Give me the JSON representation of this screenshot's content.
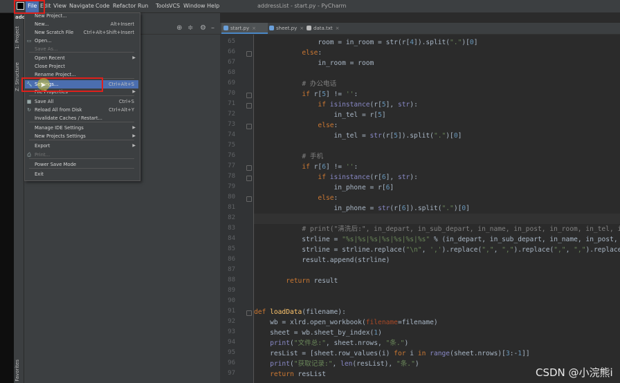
{
  "window_title": "addressList - start.py - PyCharm",
  "menubar": [
    "File",
    "Edit",
    "View",
    "Navigate",
    "Code",
    "Refactor",
    "Run",
    "Tools",
    "VCS",
    "Window",
    "Help"
  ],
  "project_title_partial": "add",
  "side_tabs": {
    "project": "1: Project",
    "structure": "Z: Structure",
    "favorites": "Favorites"
  },
  "tabs": [
    {
      "label": "start.py",
      "active": true
    },
    {
      "label": "sheet.py",
      "active": false
    },
    {
      "label": "data.txt",
      "active": false
    }
  ],
  "file_menu": [
    {
      "label": "New Project...",
      "shortcut": "",
      "submenu": false,
      "disabled": false,
      "icon": ""
    },
    {
      "label": "New...",
      "shortcut": "Alt+Insert",
      "submenu": false,
      "disabled": false,
      "icon": ""
    },
    {
      "label": "New Scratch File",
      "shortcut": "Ctrl+Alt+Shift+Insert",
      "submenu": false,
      "disabled": false,
      "icon": ""
    },
    {
      "label": "Open...",
      "shortcut": "",
      "submenu": false,
      "disabled": false,
      "icon": "folder-icon"
    },
    {
      "label": "Save As...",
      "shortcut": "",
      "submenu": false,
      "disabled": true,
      "icon": ""
    },
    {
      "label": "Open Recent",
      "shortcut": "",
      "submenu": true,
      "disabled": false,
      "icon": ""
    },
    {
      "label": "Close Project",
      "shortcut": "",
      "submenu": false,
      "disabled": false,
      "icon": ""
    },
    {
      "label": "Rename Project...",
      "shortcut": "",
      "submenu": false,
      "disabled": false,
      "icon": ""
    },
    {
      "label": "Settings...",
      "shortcut": "Ctrl+Alt+S",
      "submenu": false,
      "disabled": false,
      "icon": "wrench-icon",
      "selected": true
    },
    {
      "label": "File Properties",
      "shortcut": "",
      "submenu": true,
      "disabled": false,
      "icon": ""
    },
    {
      "label": "Save All",
      "shortcut": "Ctrl+S",
      "submenu": false,
      "disabled": false,
      "icon": "save-icon"
    },
    {
      "label": "Reload All from Disk",
      "shortcut": "Ctrl+Alt+Y",
      "submenu": false,
      "disabled": false,
      "icon": "reload-icon"
    },
    {
      "label": "Invalidate Caches / Restart...",
      "shortcut": "",
      "submenu": false,
      "disabled": false,
      "icon": ""
    },
    {
      "label": "Manage IDE Settings",
      "shortcut": "",
      "submenu": true,
      "disabled": false,
      "icon": ""
    },
    {
      "label": "New Projects Settings",
      "shortcut": "",
      "submenu": true,
      "disabled": false,
      "icon": ""
    },
    {
      "label": "Export",
      "shortcut": "",
      "submenu": true,
      "disabled": false,
      "icon": ""
    },
    {
      "label": "Print...",
      "shortcut": "",
      "submenu": false,
      "disabled": true,
      "icon": "print-icon"
    },
    {
      "label": "Power Save Mode",
      "shortcut": "",
      "submenu": false,
      "disabled": false,
      "icon": ""
    },
    {
      "label": "Exit",
      "shortcut": "",
      "submenu": false,
      "disabled": false,
      "icon": ""
    }
  ],
  "line_numbers": [
    "65",
    "66",
    "67",
    "68",
    "69",
    "70",
    "71",
    "72",
    "73",
    "74",
    "75",
    "76",
    "77",
    "78",
    "79",
    "80",
    "81",
    "82",
    "83",
    "84",
    "85",
    "86",
    "87",
    "88",
    "89",
    "90",
    "91",
    "92",
    "93",
    "94",
    "95",
    "96",
    "97"
  ],
  "code_lines": [
    [
      {
        "t": "                room = in_room = str(r[",
        "c": ""
      },
      {
        "t": "4",
        "c": "num"
      },
      {
        "t": "]).split(",
        "c": ""
      },
      {
        "t": "\".\"",
        "c": "str"
      },
      {
        "t": ")[",
        "c": ""
      },
      {
        "t": "0",
        "c": "num"
      },
      {
        "t": "]",
        "c": ""
      }
    ],
    [
      {
        "t": "            ",
        "c": ""
      },
      {
        "t": "else",
        "c": "kw"
      },
      {
        "t": ":",
        "c": ""
      }
    ],
    [
      {
        "t": "                in_room = room",
        "c": ""
      }
    ],
    [
      {
        "t": "",
        "c": ""
      }
    ],
    [
      {
        "t": "            ",
        "c": ""
      },
      {
        "t": "# 办公电话",
        "c": "cm"
      }
    ],
    [
      {
        "t": "            ",
        "c": ""
      },
      {
        "t": "if",
        "c": "kw"
      },
      {
        "t": " r[",
        "c": ""
      },
      {
        "t": "5",
        "c": "num"
      },
      {
        "t": "] != ",
        "c": ""
      },
      {
        "t": "''",
        "c": "str"
      },
      {
        "t": ":",
        "c": ""
      }
    ],
    [
      {
        "t": "                ",
        "c": ""
      },
      {
        "t": "if",
        "c": "kw"
      },
      {
        "t": " ",
        "c": ""
      },
      {
        "t": "isinstance",
        "c": "bi"
      },
      {
        "t": "(r[",
        "c": ""
      },
      {
        "t": "5",
        "c": "num"
      },
      {
        "t": "], ",
        "c": ""
      },
      {
        "t": "str",
        "c": "bi"
      },
      {
        "t": "):",
        "c": ""
      }
    ],
    [
      {
        "t": "                    in_tel = r[",
        "c": ""
      },
      {
        "t": "5",
        "c": "num"
      },
      {
        "t": "]",
        "c": ""
      }
    ],
    [
      {
        "t": "                ",
        "c": ""
      },
      {
        "t": "else",
        "c": "kw"
      },
      {
        "t": ":",
        "c": ""
      }
    ],
    [
      {
        "t": "                    in_tel = ",
        "c": ""
      },
      {
        "t": "str",
        "c": "bi"
      },
      {
        "t": "(r[",
        "c": ""
      },
      {
        "t": "5",
        "c": "num"
      },
      {
        "t": "]).split(",
        "c": ""
      },
      {
        "t": "\".\"",
        "c": "str"
      },
      {
        "t": ")[",
        "c": ""
      },
      {
        "t": "0",
        "c": "num"
      },
      {
        "t": "]",
        "c": ""
      }
    ],
    [
      {
        "t": "",
        "c": ""
      }
    ],
    [
      {
        "t": "            ",
        "c": ""
      },
      {
        "t": "# 手机",
        "c": "cm"
      }
    ],
    [
      {
        "t": "            ",
        "c": ""
      },
      {
        "t": "if",
        "c": "kw"
      },
      {
        "t": " r[",
        "c": ""
      },
      {
        "t": "6",
        "c": "num"
      },
      {
        "t": "] != ",
        "c": ""
      },
      {
        "t": "''",
        "c": "str"
      },
      {
        "t": ":",
        "c": ""
      }
    ],
    [
      {
        "t": "                ",
        "c": ""
      },
      {
        "t": "if",
        "c": "kw"
      },
      {
        "t": " ",
        "c": ""
      },
      {
        "t": "isinstance",
        "c": "bi"
      },
      {
        "t": "(r[",
        "c": ""
      },
      {
        "t": "6",
        "c": "num"
      },
      {
        "t": "], ",
        "c": ""
      },
      {
        "t": "str",
        "c": "bi"
      },
      {
        "t": "):",
        "c": ""
      }
    ],
    [
      {
        "t": "                    in_phone = r[",
        "c": ""
      },
      {
        "t": "6",
        "c": "num"
      },
      {
        "t": "]",
        "c": ""
      }
    ],
    [
      {
        "t": "                ",
        "c": ""
      },
      {
        "t": "else",
        "c": "kw"
      },
      {
        "t": ":",
        "c": ""
      }
    ],
    [
      {
        "t": "                    in_phone = ",
        "c": ""
      },
      {
        "t": "str",
        "c": "bi"
      },
      {
        "t": "(r[",
        "c": ""
      },
      {
        "t": "6",
        "c": "num"
      },
      {
        "t": "]).split(",
        "c": ""
      },
      {
        "t": "\".\"",
        "c": "str"
      },
      {
        "t": ")[",
        "c": ""
      },
      {
        "t": "0",
        "c": "num"
      },
      {
        "t": "]",
        "c": ""
      }
    ],
    [
      {
        "t": "",
        "c": ""
      }
    ],
    [
      {
        "t": "            ",
        "c": ""
      },
      {
        "t": "# print(\"清洗后:\", in_depart, in_sub_depart, in_name, in_post, in_room, in_tel, in_ph",
        "c": "cm"
      }
    ],
    [
      {
        "t": "            strline = ",
        "c": ""
      },
      {
        "t": "\"%s|%s|%s|%s|%s|%s|%s\"",
        "c": "str"
      },
      {
        "t": " % (in_depart, in_sub_depart, in_name, in_post, in_r",
        "c": ""
      }
    ],
    [
      {
        "t": "            strline = strline.replace(",
        "c": ""
      },
      {
        "t": "\"\\n\"",
        "c": "str"
      },
      {
        "t": ", ",
        "c": ""
      },
      {
        "t": "','",
        "c": "str"
      },
      {
        "t": ").replace(",
        "c": ""
      },
      {
        "t": "\",\"",
        "c": "str"
      },
      {
        "t": ", ",
        "c": ""
      },
      {
        "t": "\",\"",
        "c": "str"
      },
      {
        "t": ").replace(",
        "c": ""
      },
      {
        "t": "\",\"",
        "c": "str"
      },
      {
        "t": ", ",
        "c": ""
      },
      {
        "t": "\",\"",
        "c": "str"
      },
      {
        "t": ").replace(",
        "c": ""
      },
      {
        "t": "\"",
        "c": "str"
      }
    ],
    [
      {
        "t": "            result.append(strline)",
        "c": ""
      }
    ],
    [
      {
        "t": "",
        "c": ""
      }
    ],
    [
      {
        "t": "        ",
        "c": ""
      },
      {
        "t": "return",
        "c": "kw"
      },
      {
        "t": " result",
        "c": ""
      }
    ],
    [
      {
        "t": "",
        "c": ""
      }
    ],
    [
      {
        "t": "",
        "c": ""
      }
    ],
    [
      {
        "t": "def",
        "c": "kw"
      },
      {
        "t": " ",
        "c": ""
      },
      {
        "t": "loadData",
        "c": "fn"
      },
      {
        "t": "(filename):",
        "c": ""
      }
    ],
    [
      {
        "t": "    wb = xlrd.open_workbook(",
        "c": ""
      },
      {
        "t": "filename",
        "c": "pm"
      },
      {
        "t": "=filename)",
        "c": ""
      }
    ],
    [
      {
        "t": "    sheet = wb.sheet_by_index(",
        "c": ""
      },
      {
        "t": "1",
        "c": "num"
      },
      {
        "t": ")",
        "c": ""
      }
    ],
    [
      {
        "t": "    ",
        "c": ""
      },
      {
        "t": "print",
        "c": "bi"
      },
      {
        "t": "(",
        "c": ""
      },
      {
        "t": "\"文件总:\"",
        "c": "str"
      },
      {
        "t": ", sheet.nrows, ",
        "c": ""
      },
      {
        "t": "\"条.\"",
        "c": "str"
      },
      {
        "t": ")",
        "c": ""
      }
    ],
    [
      {
        "t": "    resList = [sheet.row_values(i) ",
        "c": ""
      },
      {
        "t": "for",
        "c": "kw"
      },
      {
        "t": " i ",
        "c": ""
      },
      {
        "t": "in",
        "c": "kw"
      },
      {
        "t": " ",
        "c": ""
      },
      {
        "t": "range",
        "c": "bi"
      },
      {
        "t": "(sheet.nrows)[",
        "c": ""
      },
      {
        "t": "3",
        "c": "num"
      },
      {
        "t": ":-",
        "c": ""
      },
      {
        "t": "1",
        "c": "num"
      },
      {
        "t": "]]",
        "c": ""
      }
    ],
    [
      {
        "t": "    ",
        "c": ""
      },
      {
        "t": "print",
        "c": "bi"
      },
      {
        "t": "(",
        "c": ""
      },
      {
        "t": "\"获取记录:\"",
        "c": "str"
      },
      {
        "t": ", ",
        "c": ""
      },
      {
        "t": "len",
        "c": "bi"
      },
      {
        "t": "(resList), ",
        "c": ""
      },
      {
        "t": "\"条.\"",
        "c": "str"
      },
      {
        "t": ")",
        "c": ""
      }
    ],
    [
      {
        "t": "    ",
        "c": ""
      },
      {
        "t": "return",
        "c": "kw"
      },
      {
        "t": " resList",
        "c": ""
      }
    ]
  ],
  "watermark": "CSDN @小浣熊i",
  "colors": {
    "accent": "#4b6eaf",
    "highlight_box": "#e0201b"
  }
}
